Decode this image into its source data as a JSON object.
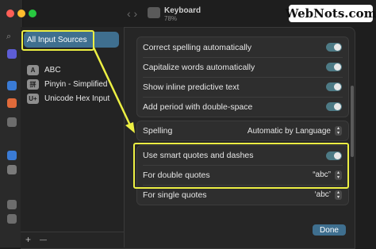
{
  "window": {
    "title": "Keyboard",
    "subtitle": "78%",
    "watermark": "WebNots.com"
  },
  "input_sources": {
    "selected_label": "All Input Sources",
    "items": [
      {
        "badge": "A",
        "label": "ABC"
      },
      {
        "badge": "拼",
        "label": "Pinyin - Simplified"
      },
      {
        "badge": "U+",
        "label": "Unicode Hex Input"
      }
    ],
    "add_symbol": "+",
    "remove_symbol": "—"
  },
  "settings": {
    "text_group": [
      {
        "label": "Correct spelling automatically",
        "on": true
      },
      {
        "label": "Capitalize words automatically",
        "on": true
      },
      {
        "label": "Show inline predictive text",
        "on": true
      },
      {
        "label": "Add period with double-space",
        "on": true
      }
    ],
    "spelling": {
      "label": "Spelling",
      "value": "Automatic by Language"
    },
    "quotes_group": {
      "smart_quotes_label": "Use smart quotes and dashes",
      "smart_quotes_on": true,
      "double_label": "For double quotes",
      "double_value": "“abc”",
      "single_label": "For single quotes",
      "single_value": "‘abc’"
    },
    "done_label": "Done"
  },
  "colors": {
    "accent": "#3f6f8f",
    "highlight": "#ecef43",
    "toggle_on": "#4d7a85"
  }
}
